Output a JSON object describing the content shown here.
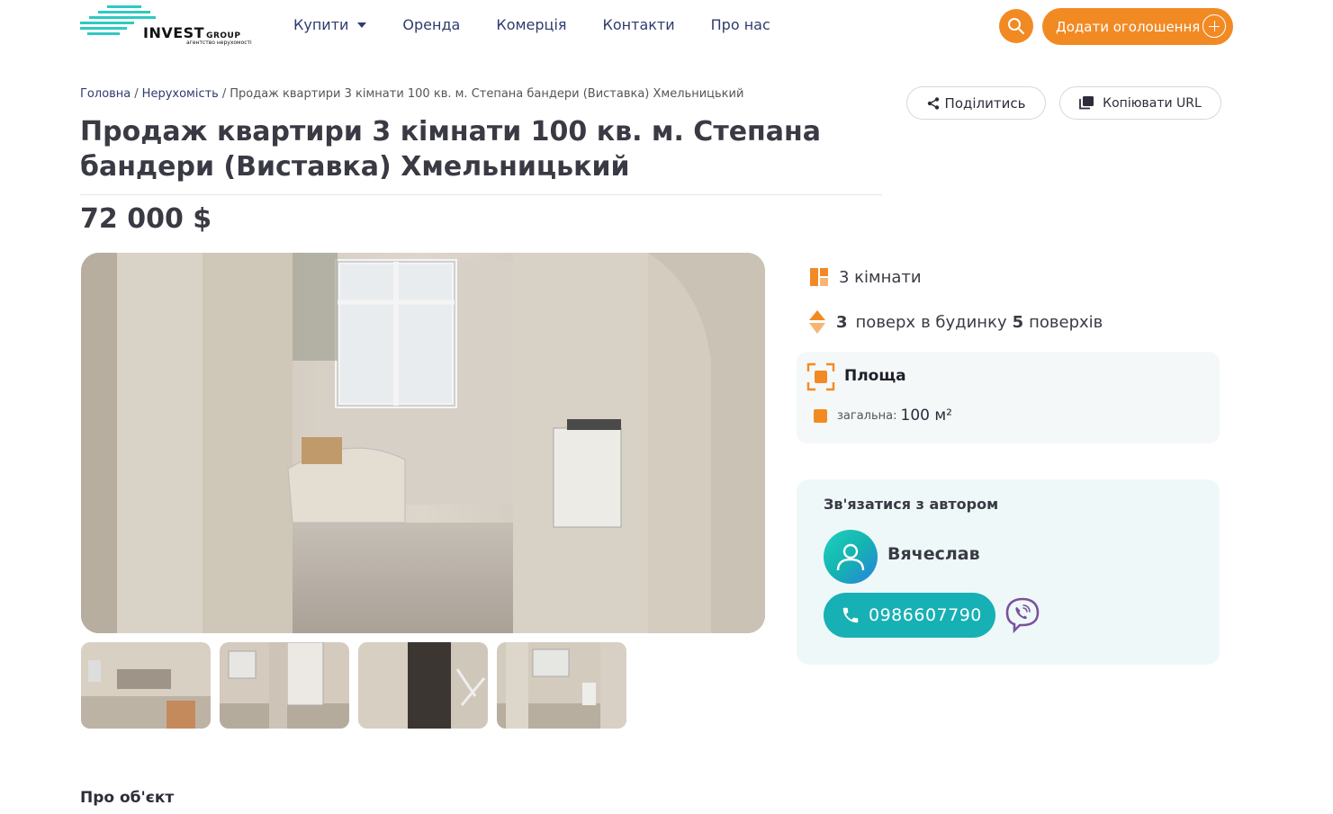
{
  "header": {
    "logo_brand": "INVEST",
    "logo_group": "GROUP",
    "logo_subtitle": "агентство нерухомості",
    "nav": [
      {
        "label": "Купити"
      },
      {
        "label": "Оренда"
      },
      {
        "label": "Комерція"
      },
      {
        "label": "Контакти"
      },
      {
        "label": "Про нас"
      }
    ],
    "add_listing_label": "Додати оголошення",
    "colors": {
      "accent": "#f28a24",
      "teal": "#17b0b4",
      "nav": "#2f3b6e"
    }
  },
  "breadcrumb": {
    "home": "Головна",
    "section": "Нерухомість",
    "current": "Продаж квартири 3 кімнати 100 кв. м. Степана бандери (Виставка) Хмельницький",
    "separator": "/"
  },
  "actions": {
    "share_label": "Поділитись",
    "copy_label": "Копіювати URL"
  },
  "listing": {
    "title": "Продаж квартири 3 кімнати 100 кв. м. Степана бандери (Виставка) Хмельницький",
    "price": "72 000 $",
    "rooms_label": "3 кімнати",
    "floor": "3",
    "floor_word": "поверх",
    "in_building": "в будинку",
    "total_floors": "5",
    "floors_word": "поверхів",
    "area_title": "Площа",
    "area_total_label": "загальна:",
    "area_total_value": "100 м²"
  },
  "contact": {
    "title": "Зв'язатися з автором",
    "agent_name": "Вячеслав",
    "phone": "0986607790"
  },
  "about": {
    "title": "Про об'єкт"
  }
}
